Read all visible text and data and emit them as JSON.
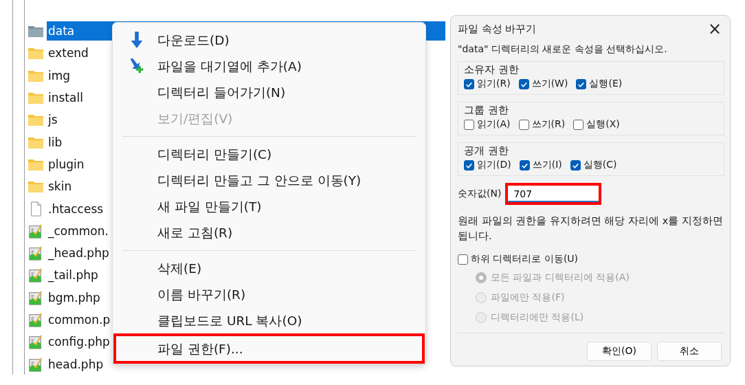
{
  "file_list": [
    {
      "name": "data",
      "kind": "folder",
      "selected": true
    },
    {
      "name": "extend",
      "kind": "folder",
      "selected": false
    },
    {
      "name": "img",
      "kind": "folder",
      "selected": false
    },
    {
      "name": "install",
      "kind": "folder",
      "selected": false
    },
    {
      "name": "js",
      "kind": "folder",
      "selected": false
    },
    {
      "name": "lib",
      "kind": "folder",
      "selected": false
    },
    {
      "name": "plugin",
      "kind": "folder",
      "selected": false
    },
    {
      "name": "skin",
      "kind": "folder",
      "selected": false
    },
    {
      "name": ".htaccess",
      "kind": "file",
      "selected": false
    },
    {
      "name": "_common.",
      "kind": "php",
      "selected": false
    },
    {
      "name": "_head.php",
      "kind": "php",
      "selected": false
    },
    {
      "name": "_tail.php",
      "kind": "php",
      "selected": false
    },
    {
      "name": "bgm.php",
      "kind": "php",
      "selected": false
    },
    {
      "name": "common.p",
      "kind": "php",
      "selected": false
    },
    {
      "name": "config.php",
      "kind": "php",
      "selected": false
    },
    {
      "name": "head.php",
      "kind": "php",
      "selected": false
    }
  ],
  "context_menu": [
    {
      "kind": "download",
      "label": "다운로드(D)",
      "disabled": false,
      "highlighted": false
    },
    {
      "kind": "queue",
      "label": "파일을 대기열에 추가(A)",
      "disabled": false,
      "highlighted": false
    },
    {
      "kind": "item",
      "label": "디렉터리 들어가기(N)",
      "disabled": false,
      "highlighted": false
    },
    {
      "kind": "item",
      "label": "보기/편집(V)",
      "disabled": true,
      "highlighted": false
    },
    {
      "kind": "separator"
    },
    {
      "kind": "item",
      "label": "디렉터리 만들기(C)",
      "disabled": false,
      "highlighted": false
    },
    {
      "kind": "item",
      "label": "디렉터리 만들고 그 안으로 이동(Y)",
      "disabled": false,
      "highlighted": false
    },
    {
      "kind": "item",
      "label": "새 파일 만들기(T)",
      "disabled": false,
      "highlighted": false
    },
    {
      "kind": "item",
      "label": "새로 고침(R)",
      "disabled": false,
      "highlighted": false
    },
    {
      "kind": "separator"
    },
    {
      "kind": "item",
      "label": "삭제(E)",
      "disabled": false,
      "highlighted": false
    },
    {
      "kind": "item",
      "label": "이름 바꾸기(R)",
      "disabled": false,
      "highlighted": false
    },
    {
      "kind": "item",
      "label": "클립보드로 URL 복사(O)",
      "disabled": false,
      "highlighted": false
    },
    {
      "kind": "item",
      "label": "파일 권한(F)...",
      "disabled": false,
      "highlighted": true
    }
  ],
  "dialog": {
    "title": "파일 속성 바꾸기",
    "close": "×",
    "intro": "\"data\" 디렉터리의 새로운 속성을 선택하십시오.",
    "groups": [
      {
        "title": "소유자 권한",
        "options": [
          {
            "label": "읽기(R)",
            "checked": true
          },
          {
            "label": "쓰기(W)",
            "checked": true
          },
          {
            "label": "실행(E)",
            "checked": true
          }
        ]
      },
      {
        "title": "그룹 권한",
        "options": [
          {
            "label": "읽기(A)",
            "checked": false
          },
          {
            "label": "쓰기(R)",
            "checked": false
          },
          {
            "label": "실행(X)",
            "checked": false
          }
        ]
      },
      {
        "title": "공개 권한",
        "options": [
          {
            "label": "읽기(D)",
            "checked": true
          },
          {
            "label": "쓰기(I)",
            "checked": true
          },
          {
            "label": "실행(C)",
            "checked": true
          }
        ]
      }
    ],
    "numeric": {
      "label": "숫자값(N)",
      "value": "707",
      "highlighted": true
    },
    "note": "원래 파일의 권한을 유지하려면 해당 자리에 x를 지정하면 됩니다.",
    "recurse": {
      "label": "하위 디렉터리로 이동(U)",
      "checked": false
    },
    "apply_options": [
      {
        "label": "모든 파일과 디렉터리에 적용(A)",
        "selected": true,
        "disabled": true
      },
      {
        "label": "파일에만 적용(F)",
        "selected": false,
        "disabled": true
      },
      {
        "label": "디렉터리에만 적용(L)",
        "selected": false,
        "disabled": true
      }
    ],
    "buttons": [
      "확인(O)",
      "취소"
    ]
  }
}
